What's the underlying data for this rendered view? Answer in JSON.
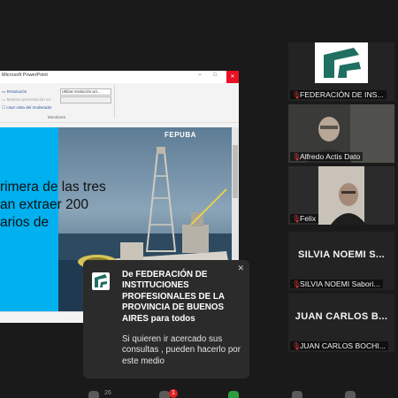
{
  "ppt": {
    "window_title": "Microsoft PowerPoint",
    "ribbon": {
      "resolution_label": "Resolución",
      "resolution_value": "Utilizar resolución act...",
      "show_on_label": "Mostrar presentación en:",
      "show_on_value": "",
      "presenter_view_label": "Usar vista del moderador",
      "group_label": "Monitores"
    },
    "slide": {
      "lines": [
        "rimera de las tres",
        "an extraer 200",
        "arios de"
      ],
      "logo": "FEPUBA"
    }
  },
  "participants": [
    {
      "name": "FEDERACIÓN DE INS...",
      "big_name": ""
    },
    {
      "name": "Alfredo Actis Dato",
      "big_name": ""
    },
    {
      "name": "Felix",
      "big_name": ""
    },
    {
      "name": "SILVIA NOEMI Sabori...",
      "big_name": "SILVIA NOEMI S..."
    },
    {
      "name": "JUAN CARLOS BOCHI...",
      "big_name": "JUAN CARLOS B..."
    }
  ],
  "chat": {
    "from": "De FEDERACIÓN DE INSTITUCIONES PROFESIONALES DE LA PROVINCIA DE BUENOS AIRES para todos",
    "message": "Si quieren ir acercado sus consultas , pueden hacerlo por este medio"
  },
  "toolbar": {
    "participants_count": "26",
    "chat_badge": "1"
  },
  "colors": {
    "slide_accent": "#00b0ef",
    "mute_red": "#e23a3a",
    "popup_bg": "#2b2b2b",
    "logo_teal": "#1f6f62"
  }
}
